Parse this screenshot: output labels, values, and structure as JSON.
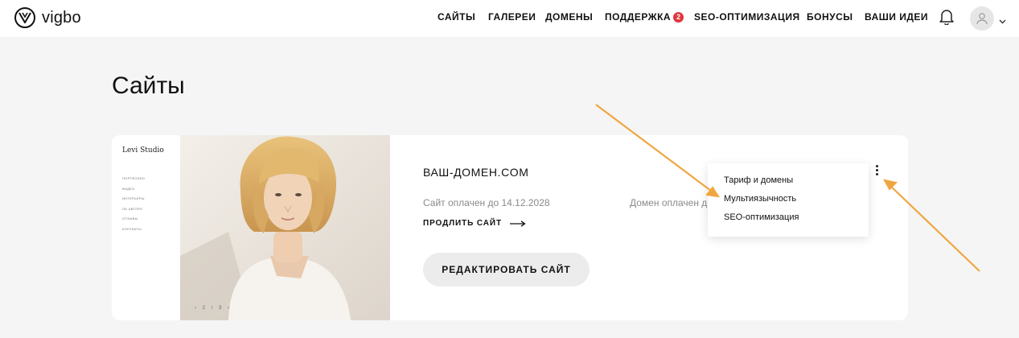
{
  "brand": {
    "name": "vigbo"
  },
  "nav": {
    "items": [
      {
        "label": "САЙТЫ"
      },
      {
        "label": "ГАЛЕРЕИ"
      },
      {
        "label": "ДОМЕНЫ"
      },
      {
        "label": "ПОДДЕРЖКА",
        "badge": "2"
      },
      {
        "label": "SEO-ОПТИМИЗАЦИЯ"
      },
      {
        "label": "БОНУСЫ"
      },
      {
        "label": "ВАШИ ИДЕИ"
      }
    ],
    "icons": [
      "bell-icon",
      "user-icon",
      "chevron-down-icon"
    ]
  },
  "page": {
    "title": "Сайты"
  },
  "site_card": {
    "preview": {
      "brand": "Levi Studio",
      "menu": [
        "портфолио",
        "видео",
        "интерьеры",
        "об авторе",
        "отзывы",
        "контакты"
      ],
      "pager": "‹ 2 / 3 ›"
    },
    "domain": "ВАШ-ДОМЕН.COM",
    "site_paid": "Сайт оплачен до 14.12.2028",
    "domain_paid": "Домен оплачен д",
    "extend_label": "ПРОДЛИТЬ САЙТ",
    "edit_label": "РЕДАКТИРОВАТЬ САЙТ"
  },
  "dropdown": {
    "items": [
      {
        "label": "Тариф и домены"
      },
      {
        "label": "Мультиязычность"
      },
      {
        "label": "SEO-оптимизация"
      }
    ]
  },
  "colors": {
    "background": "#f5f5f5",
    "badge": "#e2353b",
    "annotation_arrow": "#f0a640",
    "button_bg": "#ececec"
  }
}
